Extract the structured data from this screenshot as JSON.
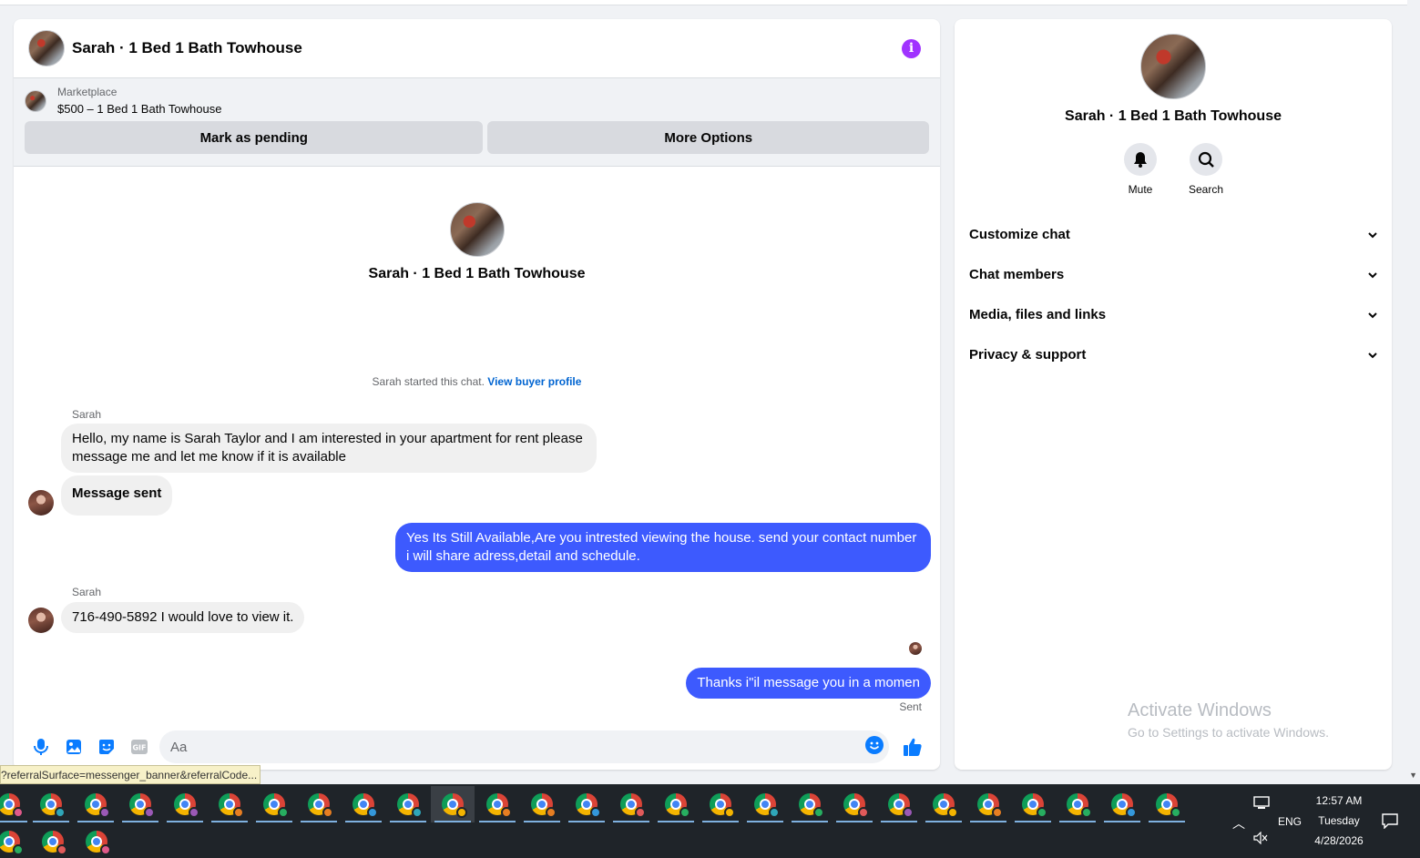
{
  "chat": {
    "title": "Sarah · 1 Bed 1 Bath Towhouse",
    "marketplace_label": "Marketplace",
    "listing": "$500 – 1 Bed 1 Bath Towhouse",
    "btn_pending": "Mark as pending",
    "btn_more": "More Options",
    "profile_name": "Sarah · 1 Bed 1 Bath Towhouse",
    "started_text": "Sarah started this chat.",
    "started_link": "View buyer profile",
    "messages": [
      {
        "sender": "Sarah",
        "text": "Hello, my name is Sarah Taylor and I am interested in your apartment for rent please message me and let me know if it is available"
      },
      {
        "text": "Message sent"
      },
      {
        "text": "Yes Its Still Available,Are you intrested viewing the house. send your contact number i will share adress,detail and schedule."
      },
      {
        "sender": "Sarah",
        "text": "716-490-5892 I would love to view it."
      },
      {
        "text": "Thanks i\"il message you in a momen"
      }
    ],
    "sent_status": "Sent",
    "input_placeholder": "Aa"
  },
  "info_panel": {
    "name": "Sarah · 1 Bed 1 Bath Towhouse",
    "actions": [
      {
        "label": "Mute",
        "icon": "bell-icon"
      },
      {
        "label": "Search",
        "icon": "search-icon"
      }
    ],
    "sections": [
      "Customize chat",
      "Chat members",
      "Media, files and links",
      "Privacy & support"
    ],
    "watermark_title": "Activate Windows",
    "watermark_sub": "Go to Settings to activate Windows."
  },
  "status_url": "?referralSurface=messenger_banner&referralCode...",
  "taskbar": {
    "language": "ENG",
    "time": "12:57 AM",
    "day": "Tuesday",
    "date": "4/28/2026",
    "profile_colors": [
      "#e05a8a",
      "#2fa6b8",
      "#9b59b6",
      "#9b59b6",
      "#9b59b6",
      "#e67e22",
      "#27ae60",
      "#e67e22",
      "#3498db",
      "#2fa6b8",
      "#f4b400",
      "#e67e22",
      "#e67e22",
      "#3498db",
      "#e05a5a",
      "#27ae60",
      "#f4b400",
      "#2fa6b8",
      "#27ae60",
      "#e05a5a",
      "#9b59b6",
      "#f4b400",
      "#e67e22",
      "#27ae60",
      "#27ae60",
      "#3498db",
      "#27ae60",
      "#27ae60",
      "#e05a5a",
      "#e05a8a"
    ]
  },
  "colors": {
    "accent": "#3d5afe",
    "info": "#a033ff",
    "link": "#0064d1",
    "messenger_blue": "#0a7cff"
  }
}
